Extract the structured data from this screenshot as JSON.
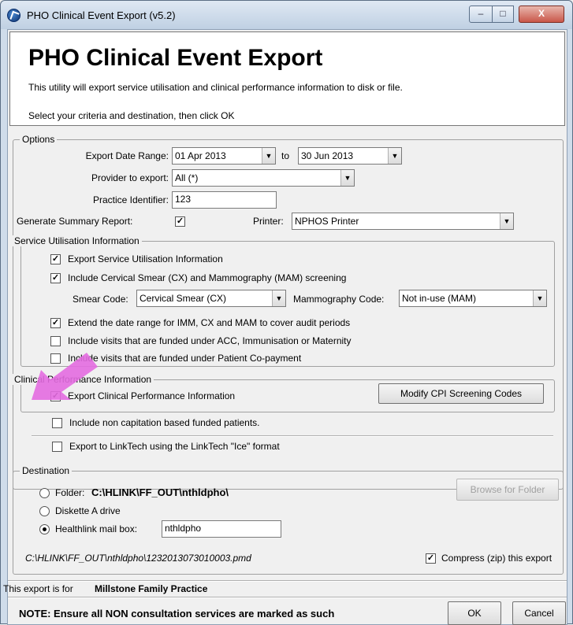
{
  "window": {
    "title": "PHO Clinical Event Export  (v5.2)",
    "min_glyph": "–",
    "max_glyph": "□",
    "close_glyph": "X"
  },
  "header": {
    "title": "PHO Clinical Event Export",
    "description": "This utility will export service utilisation and clinical performance information to disk or file.",
    "instruction": "Select your criteria and destination, then click OK"
  },
  "options": {
    "group_title": "Options",
    "date_range_label": "Export Date Range:",
    "date_from": "01 Apr 2013",
    "to_label": "to",
    "date_to": "30 Jun 2013",
    "provider_label": "Provider to export:",
    "provider_value": "All (*)",
    "practice_id_label": "Practice Identifier:",
    "practice_id_value": "123",
    "summary_label": "Generate Summary Report:",
    "summary_checked": "✓",
    "printer_label": "Printer:",
    "printer_value": "NPHOS Printer"
  },
  "service": {
    "group_title": "Service Utilisation Information",
    "export_label": "Export Service Utilisation Information",
    "export_checked": "✓",
    "cervical_label": "Include Cervical Smear (CX) and Mammography (MAM) screening",
    "cervical_checked": "✓",
    "smear_code_label": "Smear Code:",
    "smear_code_value": "Cervical Smear (CX)",
    "mammo_code_label": "Mammography Code:",
    "mammo_code_value": "Not in-use (MAM)",
    "extend_label": "Extend the date range for IMM, CX and MAM to cover audit periods",
    "extend_checked": "✓",
    "acc_label": "Include visits that are funded under ACC, Immunisation or Maternity",
    "acc_checked": "",
    "copay_label": "Include visits that are funded under Patient Co-payment",
    "copay_checked": ""
  },
  "clinical": {
    "group_title": "Clinical Performance Information",
    "export_label": "Export Clinical Performance Information",
    "export_checked": "✓",
    "modify_button": "Modify CPI Screening Codes"
  },
  "extra": {
    "noncap_label": "Include non capitation based funded patients.",
    "noncap_checked": "",
    "linktech_label": "Export to LinkTech using the LinkTech \"Ice\" format",
    "linktech_checked": ""
  },
  "destination": {
    "group_title": "Destination",
    "folder_label": "Folder:",
    "folder_path": "C:\\HLINK\\FF_OUT\\nthldpho\\",
    "browse_button": "Browse for Folder",
    "diskette_label": "Diskette A drive",
    "mailbox_label": "Healthlink mail box:",
    "mailbox_value": "nthldpho",
    "output_path": "C:\\HLINK\\FF_OUT\\nthldpho\\1232013073010003.pmd",
    "compress_label": "Compress (zip) this export",
    "compress_checked": "✓",
    "selected_option": "Healthlink mail box"
  },
  "footer": {
    "export_for_label": "This export is for",
    "practice_name": "Millstone Family Practice",
    "note": "NOTE: Ensure all NON consultation services are marked as such",
    "ok_button": "OK",
    "cancel_button": "Cancel"
  },
  "colors": {
    "annotation_arrow": "#e36ce0"
  }
}
